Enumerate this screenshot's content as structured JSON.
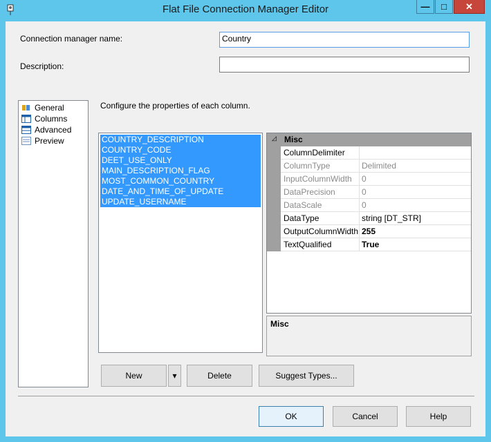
{
  "window": {
    "title": "Flat File Connection Manager Editor"
  },
  "window_controls": {
    "minimize": "—",
    "maximize": "□",
    "close": "✕"
  },
  "form": {
    "name_label": "Connection manager name:",
    "name_value": "Country",
    "description_label": "Description:",
    "description_value": ""
  },
  "nav": {
    "items": [
      {
        "label": "General",
        "icon": "general-icon"
      },
      {
        "label": "Columns",
        "icon": "columns-icon"
      },
      {
        "label": "Advanced",
        "icon": "advanced-icon"
      },
      {
        "label": "Preview",
        "icon": "preview-icon"
      }
    ]
  },
  "main": {
    "instruction": "Configure the properties of each column.",
    "columns": [
      "COUNTRY_DESCRIPTION",
      "COUNTRY_CODE",
      "DEET_USE_ONLY",
      "MAIN_DESCRIPTION_FLAG",
      "MOST_COMMON_COUNTRY",
      "DATE_AND_TIME_OF_UPDATE",
      "UPDATE_USERNAME"
    ]
  },
  "properties": {
    "category": "Misc",
    "rows": [
      {
        "name": "ColumnDelimiter",
        "value": ""
      },
      {
        "name": "ColumnType",
        "value": "Delimited"
      },
      {
        "name": "InputColumnWidth",
        "value": "0"
      },
      {
        "name": "DataPrecision",
        "value": "0"
      },
      {
        "name": "DataScale",
        "value": "0"
      },
      {
        "name": "DataType",
        "value": "string [DT_STR]"
      },
      {
        "name": "OutputColumnWidth",
        "value": "255"
      },
      {
        "name": "TextQualified",
        "value": "True"
      }
    ],
    "description_title": "Misc"
  },
  "buttons": {
    "new": "New",
    "new_dropdown": "▾",
    "delete": "Delete",
    "suggest": "Suggest Types...",
    "ok": "OK",
    "cancel": "Cancel",
    "help": "Help"
  }
}
